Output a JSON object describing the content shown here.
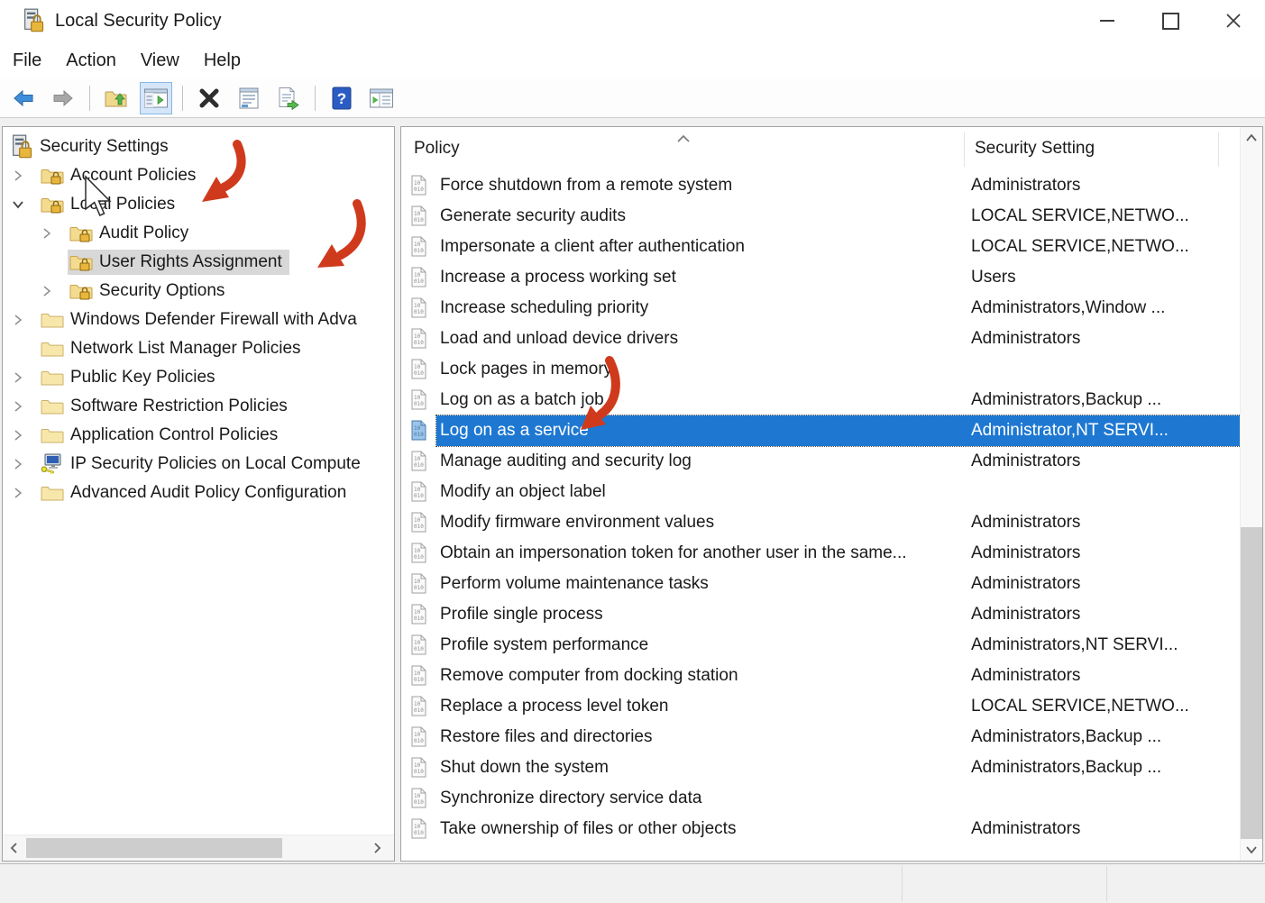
{
  "window": {
    "title": "Local Security Policy",
    "controls": [
      "minimize",
      "maximize",
      "close"
    ]
  },
  "menu": {
    "items": [
      "File",
      "Action",
      "View",
      "Help"
    ]
  },
  "toolbar": {
    "buttons": [
      "back",
      "forward",
      "up-one-level",
      "show-console-tree",
      "delete",
      "properties",
      "export-list",
      "help",
      "new-window"
    ],
    "active": "show-console-tree"
  },
  "tree": {
    "items": [
      {
        "label": "Security Settings",
        "level": 0,
        "icon": "security-root",
        "expander": "none",
        "selected": false
      },
      {
        "label": "Account Policies",
        "level": 1,
        "icon": "folder-lock",
        "expander": "collapsed",
        "selected": false
      },
      {
        "label": "Local Policies",
        "level": 1,
        "icon": "folder-lock",
        "expander": "expanded",
        "selected": false
      },
      {
        "label": "Audit Policy",
        "level": 2,
        "icon": "folder-lock",
        "expander": "collapsed",
        "selected": false
      },
      {
        "label": "User Rights Assignment",
        "level": 2,
        "icon": "folder-lock",
        "expander": "none",
        "selected": true
      },
      {
        "label": "Security Options",
        "level": 2,
        "icon": "folder-lock",
        "expander": "collapsed",
        "selected": false
      },
      {
        "label": "Windows Defender Firewall with Adva",
        "level": 1,
        "icon": "folder",
        "expander": "collapsed",
        "selected": false
      },
      {
        "label": "Network List Manager Policies",
        "level": 1,
        "icon": "folder",
        "expander": "none",
        "selected": false
      },
      {
        "label": "Public Key Policies",
        "level": 1,
        "icon": "folder",
        "expander": "collapsed",
        "selected": false
      },
      {
        "label": "Software Restriction Policies",
        "level": 1,
        "icon": "folder",
        "expander": "collapsed",
        "selected": false
      },
      {
        "label": "Application Control Policies",
        "level": 1,
        "icon": "folder",
        "expander": "collapsed",
        "selected": false
      },
      {
        "label": "IP Security Policies on Local Compute",
        "level": 1,
        "icon": "computer-key",
        "expander": "collapsed",
        "selected": false
      },
      {
        "label": "Advanced Audit Policy Configuration",
        "level": 1,
        "icon": "folder",
        "expander": "collapsed",
        "selected": false
      }
    ]
  },
  "list": {
    "columns": [
      "Policy",
      "Security Setting"
    ],
    "sort": {
      "column": "Policy",
      "direction": "ascending"
    },
    "rows": [
      {
        "policy": "Force shutdown from a remote system",
        "setting": "Administrators",
        "selected": false
      },
      {
        "policy": "Generate security audits",
        "setting": "LOCAL SERVICE,NETWO...",
        "selected": false
      },
      {
        "policy": "Impersonate a client after authentication",
        "setting": "LOCAL SERVICE,NETWO...",
        "selected": false
      },
      {
        "policy": "Increase a process working set",
        "setting": "Users",
        "selected": false
      },
      {
        "policy": "Increase scheduling priority",
        "setting": "Administrators,Window ...",
        "selected": false
      },
      {
        "policy": "Load and unload device drivers",
        "setting": "Administrators",
        "selected": false
      },
      {
        "policy": "Lock pages in memory",
        "setting": "",
        "selected": false
      },
      {
        "policy": "Log on as a batch job",
        "setting": "Administrators,Backup ...",
        "selected": false
      },
      {
        "policy": "Log on as a service",
        "setting": "Administrator,NT SERVI...",
        "selected": true
      },
      {
        "policy": "Manage auditing and security log",
        "setting": "Administrators",
        "selected": false
      },
      {
        "policy": "Modify an object label",
        "setting": "",
        "selected": false
      },
      {
        "policy": "Modify firmware environment values",
        "setting": "Administrators",
        "selected": false
      },
      {
        "policy": "Obtain an impersonation token for another user in the same...",
        "setting": "Administrators",
        "selected": false
      },
      {
        "policy": "Perform volume maintenance tasks",
        "setting": "Administrators",
        "selected": false
      },
      {
        "policy": "Profile single process",
        "setting": "Administrators",
        "selected": false
      },
      {
        "policy": "Profile system performance",
        "setting": "Administrators,NT SERVI...",
        "selected": false
      },
      {
        "policy": "Remove computer from docking station",
        "setting": "Administrators",
        "selected": false
      },
      {
        "policy": "Replace a process level token",
        "setting": "LOCAL SERVICE,NETWO...",
        "selected": false
      },
      {
        "policy": "Restore files and directories",
        "setting": "Administrators,Backup ...",
        "selected": false
      },
      {
        "policy": "Shut down the system",
        "setting": "Administrators,Backup ...",
        "selected": false
      },
      {
        "policy": "Synchronize directory service data",
        "setting": "",
        "selected": false
      },
      {
        "policy": "Take ownership of files or other objects",
        "setting": "Administrators",
        "selected": false
      }
    ]
  },
  "statusbar": {
    "text": ""
  },
  "annotations": {
    "arrow_color": "#cf3a1d",
    "arrows_point_at": [
      "Local Policies",
      "User Rights Assignment",
      "Log on as a service"
    ],
    "cursor_near": "Account Policies"
  },
  "colors": {
    "list_selection": "#1e78d2",
    "tree_selection": "#d8d8d8",
    "toolbar_active_bg": "#d4e6f8",
    "statusbar_bg": "#f1f1f1"
  }
}
